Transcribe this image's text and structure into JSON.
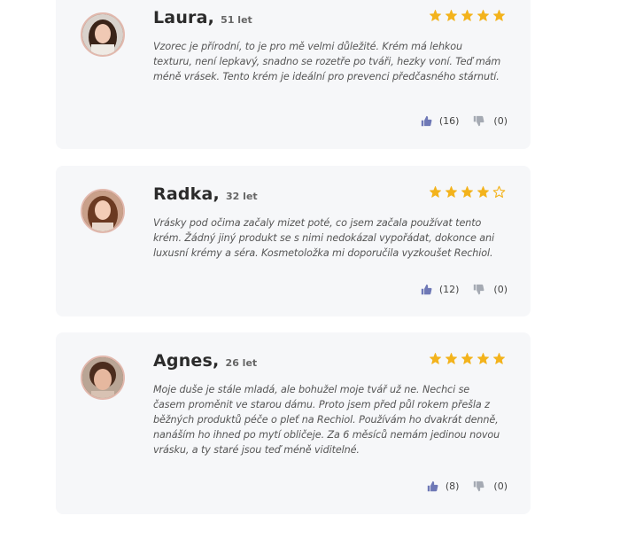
{
  "colors": {
    "star": "#f3b31c",
    "like": "#6e78b6",
    "dislike": "#a5aab3"
  },
  "reviews": [
    {
      "name": "Laura,",
      "age": "51 let",
      "rating": 5,
      "text": "Vzorec je přírodní, to je pro mě velmi důležité. Krém má lehkou texturu, není lepkavý, snadno se rozetře po tváři, hezky voní. Teď mám méně vrásek. Tento krém je ideální pro prevenci předčasného stárnutí.",
      "likes": "(16)",
      "dislikes": "(0)"
    },
    {
      "name": "Radka,",
      "age": "32 let",
      "rating": 4,
      "text": "Vrásky pod očima začaly mizet poté, co jsem začala používat tento krém. Žádný jiný produkt se s nimi nedokázal vypořádat, dokonce ani luxusní krémy a séra. Kosmetoložka mi doporučila vyzkoušet Rechiol.",
      "likes": "(12)",
      "dislikes": "(0)"
    },
    {
      "name": "Agnes,",
      "age": "26 let",
      "rating": 5,
      "text": "Moje duše je stále mladá, ale bohužel moje tvář už ne. Nechci se časem proměnit ve starou dámu. Proto jsem před půl rokem přešla z běžných produktů péče o pleť na Rechiol. Používám ho dvakrát denně, nanáším ho ihned po mytí obličeje. Za 6 měsíců nemám jedinou novou vrásku, a ty staré jsou teď méně viditelné.",
      "likes": "(8)",
      "dislikes": "(0)"
    }
  ]
}
